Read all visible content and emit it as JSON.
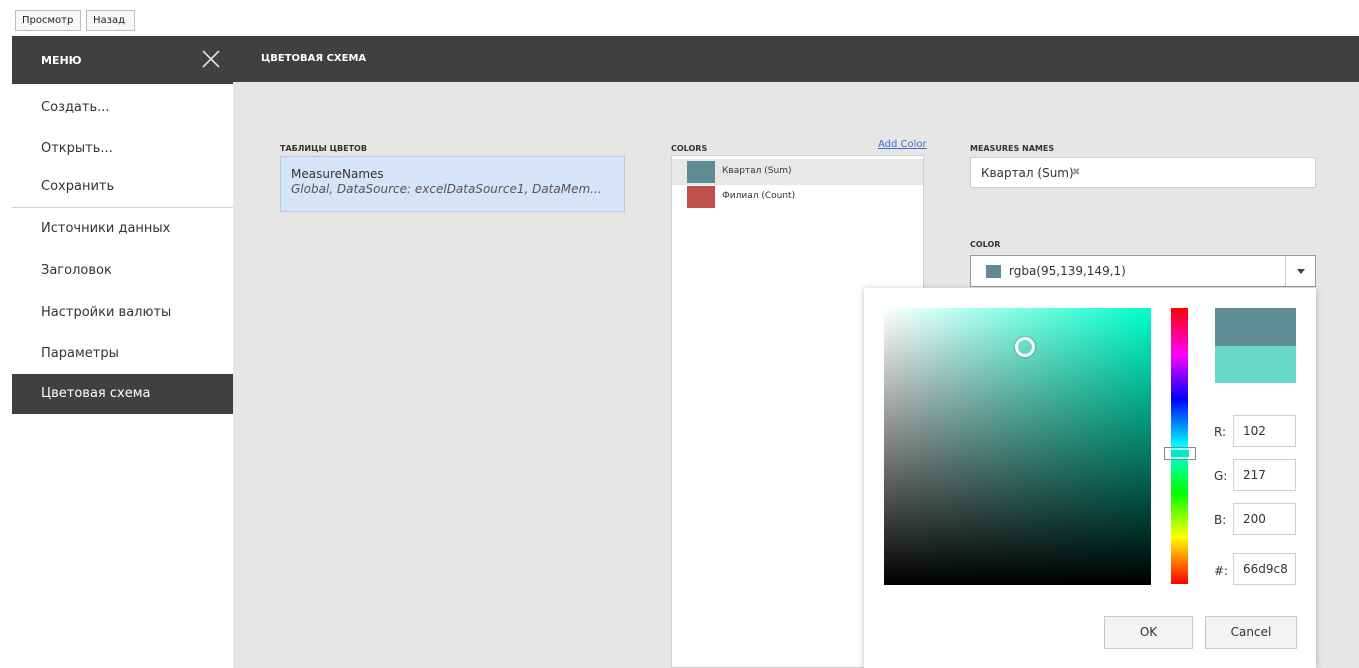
{
  "toolbar": {
    "preview_label": "Просмотр",
    "back_label": "Назад"
  },
  "menu": {
    "title": "МЕНЮ",
    "items": [
      {
        "label": "Создать..."
      },
      {
        "label": "Открыть..."
      },
      {
        "label": "Сохранить"
      },
      {
        "label": "Источники данных"
      },
      {
        "label": "Заголовок"
      },
      {
        "label": "Настройки валюты"
      },
      {
        "label": "Параметры"
      },
      {
        "label": "Цветовая схема",
        "active": true
      }
    ]
  },
  "main": {
    "title": "ЦВЕТОВАЯ СХЕМА"
  },
  "color_tables": {
    "label": "ТАБЛИЦЫ ЦВЕТОВ",
    "selected": {
      "name": "MeasureNames",
      "description": "Global, DataSource: excelDataSource1, DataMem..."
    }
  },
  "colors": {
    "label": "COLORS",
    "add_label": "Add Color",
    "items": [
      {
        "label": "Квартал (Sum)",
        "color": "#5f8b95"
      },
      {
        "label": "Филиал (Count)",
        "color": "#c0504d"
      }
    ]
  },
  "measures": {
    "label": "MEASURES NAMES",
    "tag": "Квартал (Sum)"
  },
  "color_field": {
    "label": "COLOR",
    "value": "rgba(95,139,149,1)",
    "swatch": "#5f8b95"
  },
  "picker": {
    "hue_color": "#00ffcc",
    "new_color": "#5f8b95",
    "old_color": "#66d9c8",
    "r_label": "R:",
    "r": "102",
    "g_label": "G:",
    "g": "217",
    "b_label": "B:",
    "b": "200",
    "hex_label": "#:",
    "hex": "66d9c8",
    "ok_label": "OK",
    "cancel_label": "Cancel"
  }
}
